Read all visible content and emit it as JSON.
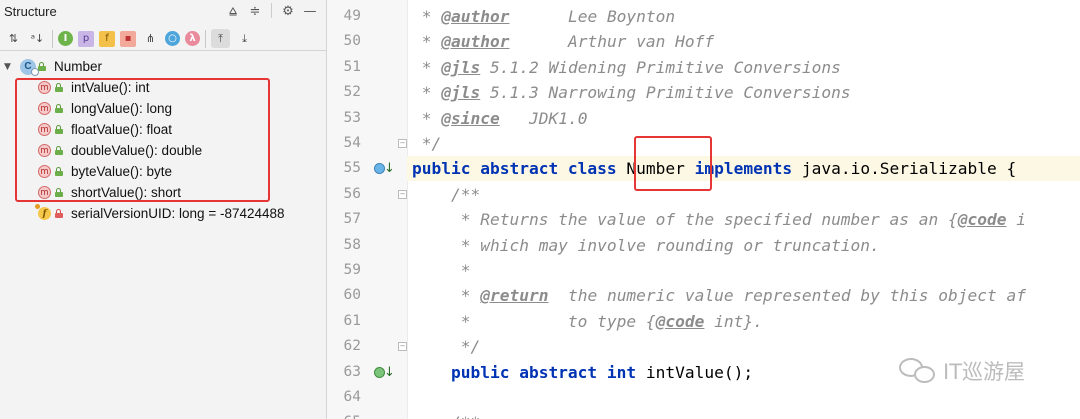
{
  "structure": {
    "title": "Structure",
    "header_icons": [
      "align-top-icon",
      "align-center-icon",
      "gear-icon",
      "minimize-icon"
    ],
    "toolbar_icons": [
      {
        "name": "sort-by-visibility-icon",
        "glyph": "↓"
      },
      {
        "name": "sort-alphabetically-icon",
        "glyph": "a↓"
      },
      {
        "name": "show-inherited-icon",
        "glyph": "I"
      },
      {
        "name": "show-properties-icon",
        "glyph": "p"
      },
      {
        "name": "show-fields-icon",
        "glyph": "f"
      },
      {
        "name": "show-non-public-icon",
        "glyph": "🔒"
      },
      {
        "name": "show-hierarchy-icon",
        "glyph": "⋔"
      },
      {
        "name": "show-anonymous-icon",
        "glyph": "○"
      },
      {
        "name": "show-lambdas-icon",
        "glyph": "λ"
      },
      {
        "name": "autoscroll-to-source-icon",
        "glyph": "⇞"
      },
      {
        "name": "autoscroll-from-source-icon",
        "glyph": "⇟"
      }
    ],
    "root": {
      "icon": "class-icon",
      "glyph": "C",
      "label": "Number"
    },
    "methods": [
      {
        "label": "intValue(): int"
      },
      {
        "label": "longValue(): long"
      },
      {
        "label": "floatValue(): float"
      },
      {
        "label": "doubleValue(): double"
      },
      {
        "label": "byteValue(): byte"
      },
      {
        "label": "shortValue(): short"
      }
    ],
    "method_glyph": "m",
    "field": {
      "glyph": "f",
      "label": "serialVersionUID: long = -87424488"
    }
  },
  "editor": {
    "lines": [
      {
        "num": "49",
        "tokens": [
          {
            "t": "doc",
            "v": " * "
          },
          {
            "t": "tag",
            "v": "@author"
          },
          {
            "t": "doc",
            "v": "      Lee Boynton"
          }
        ]
      },
      {
        "num": "50",
        "tokens": [
          {
            "t": "doc",
            "v": " * "
          },
          {
            "t": "tag",
            "v": "@author"
          },
          {
            "t": "doc",
            "v": "      Arthur van Hoff"
          }
        ]
      },
      {
        "num": "51",
        "tokens": [
          {
            "t": "doc",
            "v": " * "
          },
          {
            "t": "tag",
            "v": "@jls"
          },
          {
            "t": "doc",
            "v": " 5.1.2 Widening Primitive Conversions"
          }
        ]
      },
      {
        "num": "52",
        "tokens": [
          {
            "t": "doc",
            "v": " * "
          },
          {
            "t": "tag",
            "v": "@jls"
          },
          {
            "t": "doc",
            "v": " 5.1.3 Narrowing Primitive Conversions"
          }
        ]
      },
      {
        "num": "53",
        "tokens": [
          {
            "t": "doc",
            "v": " * "
          },
          {
            "t": "tag",
            "v": "@since"
          },
          {
            "t": "doc",
            "v": "   JDK1.0"
          }
        ]
      },
      {
        "num": "54",
        "tokens": [
          {
            "t": "doc",
            "v": " */"
          }
        ]
      },
      {
        "num": "55",
        "tokens": [
          {
            "t": "kw",
            "v": "public abstract class "
          },
          {
            "t": "sym",
            "v": "Number "
          },
          {
            "t": "kw",
            "v": "implements "
          },
          {
            "t": "sym",
            "v": "java.io.Serializable {"
          }
        ]
      },
      {
        "num": "56",
        "tokens": [
          {
            "t": "doc",
            "v": "    /**"
          }
        ]
      },
      {
        "num": "57",
        "tokens": [
          {
            "t": "doc",
            "v": "     * Returns the value of the specified number as an {"
          },
          {
            "t": "tag",
            "v": "@code"
          },
          {
            "t": "doc",
            "v": " i"
          }
        ]
      },
      {
        "num": "58",
        "tokens": [
          {
            "t": "doc",
            "v": "     * which may involve rounding or truncation."
          }
        ]
      },
      {
        "num": "59",
        "tokens": [
          {
            "t": "doc",
            "v": "     *"
          }
        ]
      },
      {
        "num": "60",
        "tokens": [
          {
            "t": "doc",
            "v": "     * "
          },
          {
            "t": "tag",
            "v": "@return"
          },
          {
            "t": "doc",
            "v": "  the numeric value represented by this object af"
          }
        ]
      },
      {
        "num": "61",
        "tokens": [
          {
            "t": "doc",
            "v": "     *          to type {"
          },
          {
            "t": "tag",
            "v": "@code"
          },
          {
            "t": "doc",
            "v": " int}."
          }
        ]
      },
      {
        "num": "62",
        "tokens": [
          {
            "t": "doc",
            "v": "     */"
          }
        ]
      },
      {
        "num": "63",
        "tokens": [
          {
            "t": "kw",
            "v": "    public abstract int "
          },
          {
            "t": "sym",
            "v": "intValue();"
          }
        ]
      },
      {
        "num": "64",
        "tokens": []
      },
      {
        "num": "65",
        "tokens": [
          {
            "t": "doc",
            "v": "    /**"
          }
        ]
      }
    ]
  },
  "watermark": {
    "text": "IT巡游屋"
  }
}
